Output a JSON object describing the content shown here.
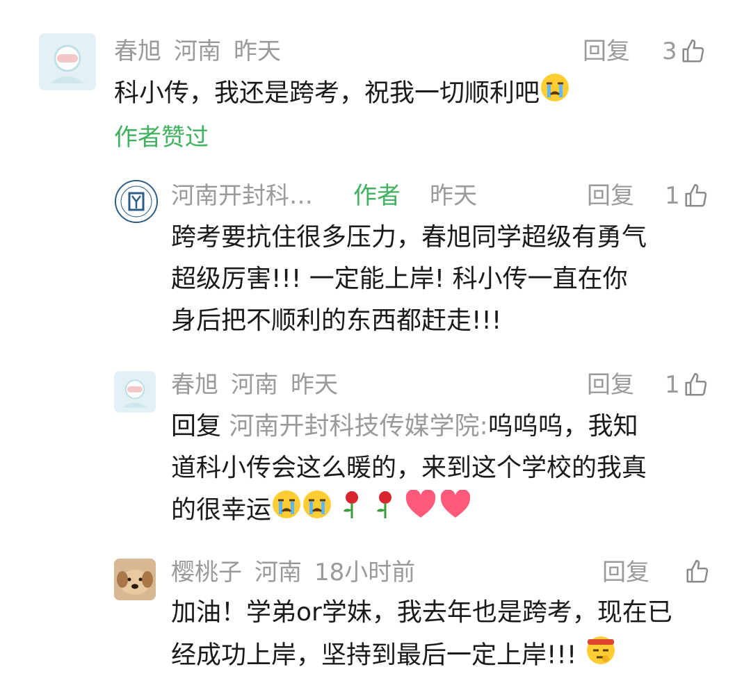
{
  "comments": [
    {
      "user": "春旭",
      "region": "河南",
      "time": "昨天",
      "reply_label": "回复",
      "likes": "3",
      "text": "科小传，我还是跨考，祝我一切顺利吧",
      "author_liked": "作者赞过"
    },
    {
      "user": "河南开封科…",
      "author_tag": "作者",
      "time": "昨天",
      "reply_label": "回复",
      "likes": "1",
      "lines": [
        "跨考要抗住很多压力，春旭同学超级有勇气",
        "超级厉害!!! 一定能上岸! 科小传一直在你",
        "身后把不顺利的东西都赶走!!!"
      ]
    },
    {
      "user": "春旭",
      "region": "河南",
      "time": "昨天",
      "reply_label": "回复",
      "likes": "1",
      "reply_prefix": "回复",
      "reply_to": "河南开封科技传媒学院:",
      "line1_rest": "呜呜呜，我知",
      "line2": "道科小传会这么暖的，来到这个学校的我真",
      "line3": "的很幸运"
    },
    {
      "user": "樱桃子",
      "region": "河南",
      "time": "18小时前",
      "reply_label": "回复",
      "likes": "",
      "lines": [
        "加油！学弟or学妹，我去年也是跨考，现在已",
        "经成功上岸，坚持到最后一定上岸!!!"
      ]
    }
  ],
  "colors": {
    "accent": "#3fb15f",
    "muted": "#9a9a9a",
    "text": "#1a1a1a"
  }
}
